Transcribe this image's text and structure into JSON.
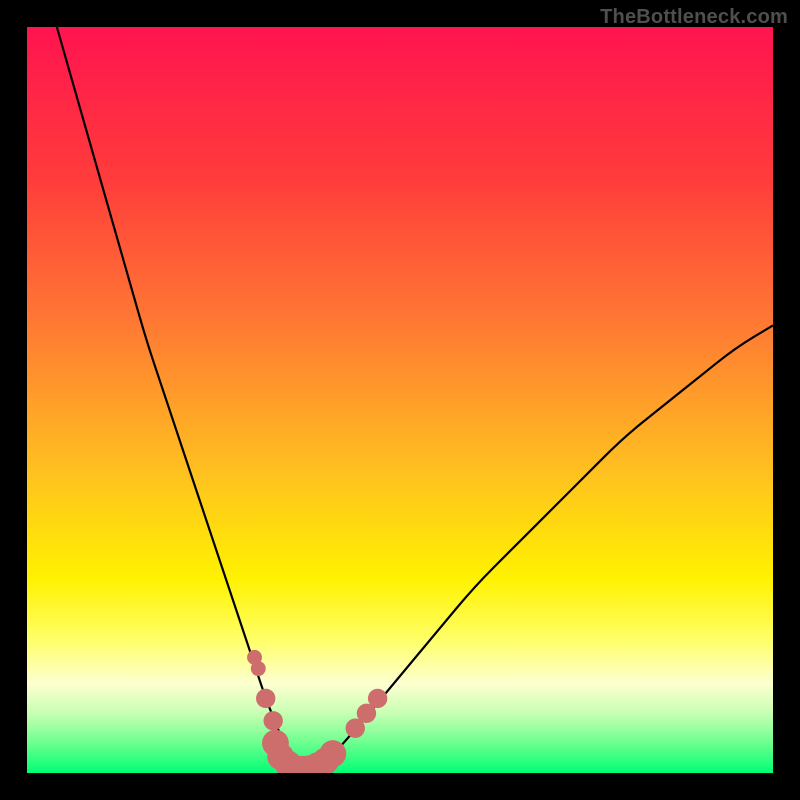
{
  "watermark": "TheBottleneck.com",
  "chart_data": {
    "type": "line",
    "title": "",
    "xlabel": "",
    "ylabel": "",
    "xlim": [
      0,
      100
    ],
    "ylim": [
      0,
      100
    ],
    "series": [
      {
        "name": "curve",
        "x": [
          4,
          6,
          8,
          10,
          12,
          14,
          16,
          18,
          20,
          22,
          24,
          26,
          28,
          30,
          31,
          32,
          33,
          34,
          35,
          36,
          37,
          38,
          39,
          40,
          42,
          45,
          50,
          55,
          60,
          65,
          70,
          75,
          80,
          85,
          90,
          95,
          100
        ],
        "y": [
          100,
          93,
          86,
          79,
          72,
          65,
          58,
          52,
          46,
          40,
          34,
          28,
          22,
          16,
          13,
          10,
          7.5,
          5,
          3,
          1.5,
          0.8,
          0.5,
          0.8,
          1.5,
          3.5,
          7,
          13,
          19,
          25,
          30,
          35,
          40,
          45,
          49,
          53,
          57,
          60
        ]
      }
    ],
    "markers": [
      {
        "x": 30.5,
        "y": 15.5,
        "r": 1.0
      },
      {
        "x": 31.0,
        "y": 14.0,
        "r": 1.0
      },
      {
        "x": 32.0,
        "y": 10.0,
        "r": 1.3
      },
      {
        "x": 33.0,
        "y": 7.0,
        "r": 1.3
      },
      {
        "x": 33.3,
        "y": 4.0,
        "r": 1.8
      },
      {
        "x": 34.0,
        "y": 2.2,
        "r": 1.8
      },
      {
        "x": 35.0,
        "y": 1.2,
        "r": 1.8
      },
      {
        "x": 36.0,
        "y": 0.6,
        "r": 1.8
      },
      {
        "x": 37.0,
        "y": 0.5,
        "r": 1.8
      },
      {
        "x": 38.0,
        "y": 0.6,
        "r": 1.8
      },
      {
        "x": 39.0,
        "y": 1.0,
        "r": 1.8
      },
      {
        "x": 40.0,
        "y": 1.6,
        "r": 1.8
      },
      {
        "x": 41.0,
        "y": 2.6,
        "r": 1.8
      },
      {
        "x": 44.0,
        "y": 6.0,
        "r": 1.3
      },
      {
        "x": 45.5,
        "y": 8.0,
        "r": 1.3
      },
      {
        "x": 47.0,
        "y": 10.0,
        "r": 1.3
      }
    ],
    "gradient_stops": [
      {
        "offset": 0,
        "color": "#ff1450"
      },
      {
        "offset": 0.2,
        "color": "#ff3b3b"
      },
      {
        "offset": 0.4,
        "color": "#ff7a33"
      },
      {
        "offset": 0.6,
        "color": "#ffc21f"
      },
      {
        "offset": 0.74,
        "color": "#fff200"
      },
      {
        "offset": 0.82,
        "color": "#ffff66"
      },
      {
        "offset": 0.88,
        "color": "#fdffd0"
      },
      {
        "offset": 0.92,
        "color": "#c8ffb3"
      },
      {
        "offset": 0.96,
        "color": "#6bff8f"
      },
      {
        "offset": 1.0,
        "color": "#00ff73"
      }
    ],
    "marker_color": "#cd6e6d",
    "curve_color": "#000000"
  }
}
